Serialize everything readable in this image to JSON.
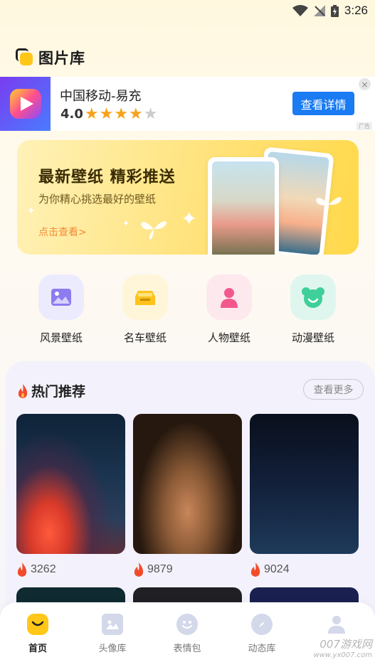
{
  "status_bar": {
    "time": "3:26"
  },
  "app": {
    "title": "图片库"
  },
  "ad": {
    "name": "中国移动-易充",
    "rating": "4.0",
    "stars_filled": 4,
    "stars_total": 5,
    "cta": "查看详情",
    "close": "×",
    "tag": "广告"
  },
  "hero": {
    "title": "最新壁纸 精彩推送",
    "subtitle": "为你精心挑选最好的壁纸",
    "link": "点击查看>"
  },
  "categories": [
    {
      "label": "风景壁纸",
      "icon": "landscape-icon",
      "bg": "#ecebfd",
      "color": "#8d7cf0"
    },
    {
      "label": "名车壁纸",
      "icon": "car-icon",
      "bg": "#fff6da",
      "color": "#ffc21a"
    },
    {
      "label": "人物壁纸",
      "icon": "person-icon",
      "bg": "#fde8ee",
      "color": "#f2588d"
    },
    {
      "label": "动漫壁纸",
      "icon": "bear-icon",
      "bg": "#dff6ef",
      "color": "#3fcf9a"
    }
  ],
  "hot": {
    "title": "热门推荐",
    "more": "查看更多",
    "items": [
      {
        "count": "3262"
      },
      {
        "count": "9879"
      },
      {
        "count": "9024"
      }
    ]
  },
  "nav": [
    {
      "label": "首页",
      "icon": "home-icon",
      "active": true
    },
    {
      "label": "头像库",
      "icon": "image-icon",
      "active": false
    },
    {
      "label": "表情包",
      "icon": "smile-icon",
      "active": false
    },
    {
      "label": "动态库",
      "icon": "compass-icon",
      "active": false
    },
    {
      "label": "",
      "icon": "profile-icon",
      "active": false
    }
  ],
  "watermark": {
    "main": "007游戏网",
    "sub": "www.yx007.com"
  },
  "colors": {
    "accent": "#ffc718",
    "cta": "#1a7bf2",
    "star": "#f7a21b"
  }
}
